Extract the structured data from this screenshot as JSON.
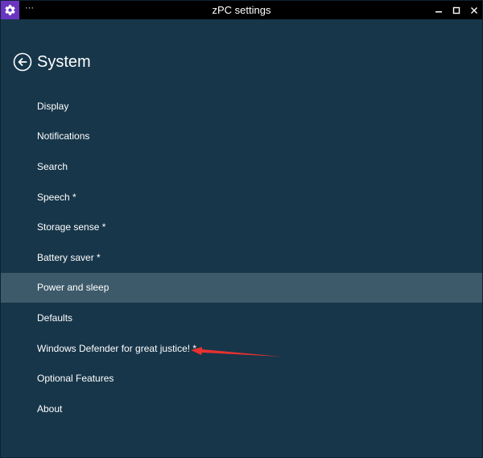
{
  "window": {
    "title": "zPC settings",
    "more_label": "···",
    "icon": "gear-icon",
    "accent": "#6a35c0"
  },
  "page": {
    "title": "System",
    "back_icon": "back-arrow-icon"
  },
  "nav": {
    "selected_index": 6,
    "items": [
      {
        "label": "Display"
      },
      {
        "label": "Notifications"
      },
      {
        "label": "Search"
      },
      {
        "label": "Speech *"
      },
      {
        "label": "Storage sense *"
      },
      {
        "label": "Battery saver *"
      },
      {
        "label": "Power and sleep"
      },
      {
        "label": "Defaults"
      },
      {
        "label": "Windows Defender for great justice! *"
      },
      {
        "label": "Optional Features"
      },
      {
        "label": "About"
      }
    ]
  },
  "colors": {
    "background": "#17364a",
    "selected": "#3d5a6b",
    "titlebar": "#000000",
    "annotation_arrow": "#e8312f"
  }
}
